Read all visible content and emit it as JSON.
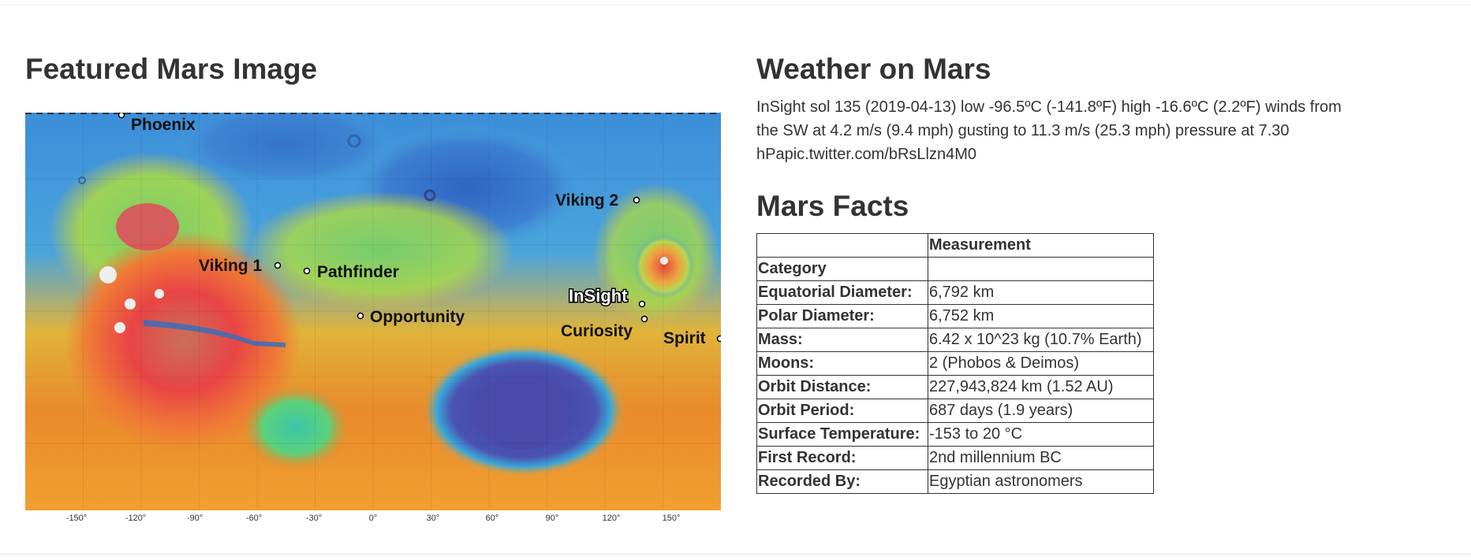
{
  "featured": {
    "title": "Featured Mars Image",
    "map": {
      "labels": {
        "phoenix": "Phoenix",
        "viking1": "Viking 1",
        "pathfinder": "Pathfinder",
        "opportunity": "Opportunity",
        "viking2": "Viking 2",
        "insight": "InSight",
        "curiosity": "Curiosity",
        "spirit": "Spirit"
      },
      "ticks": [
        "-150°",
        "-120°",
        "-90°",
        "-60°",
        "-30°",
        "0°",
        "30°",
        "60°",
        "90°",
        "120°",
        "150°"
      ]
    }
  },
  "weather": {
    "title": "Weather on Mars",
    "text": "InSight sol 135 (2019-04-13) low -96.5ºC (-141.8ºF) high -16.6ºC (2.2ºF) winds from the SW at 4.2 m/s (9.4 mph) gusting to 11.3 m/s (25.3 mph) pressure at 7.30 hPapic.twitter.com/bRsLlzn4M0"
  },
  "facts": {
    "title": "Mars Facts",
    "header_col2": "Measurement",
    "header_row": "Category",
    "rows": [
      {
        "label": "Equatorial Diameter:",
        "value": "6,792 km"
      },
      {
        "label": "Polar Diameter:",
        "value": "6,752 km"
      },
      {
        "label": "Mass:",
        "value": "6.42 x 10^23 kg (10.7% Earth)"
      },
      {
        "label": "Moons:",
        "value": "2 (Phobos & Deimos)"
      },
      {
        "label": "Orbit Distance:",
        "value": "227,943,824 km (1.52 AU)"
      },
      {
        "label": "Orbit Period:",
        "value": "687 days (1.9 years)"
      },
      {
        "label": "Surface Temperature:",
        "value": "-153 to 20 °C"
      },
      {
        "label": "First Record:",
        "value": "2nd millennium BC"
      },
      {
        "label": "Recorded By:",
        "value": "Egyptian astronomers"
      }
    ]
  }
}
